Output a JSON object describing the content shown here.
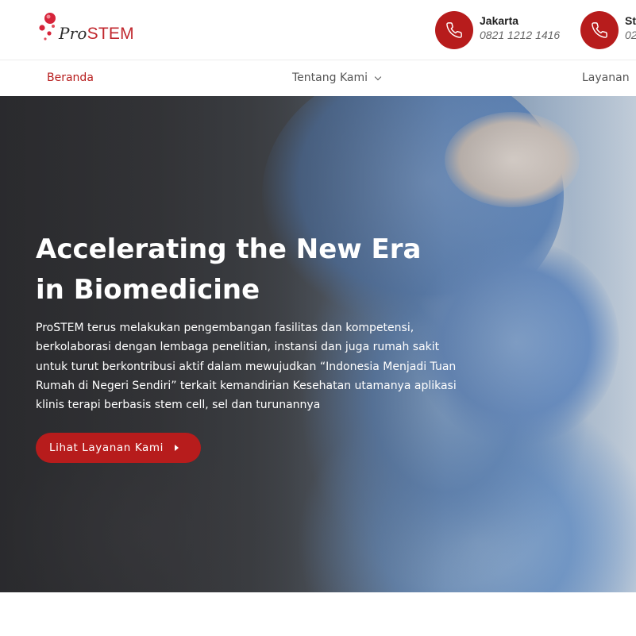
{
  "brand": {
    "logo_prefix": "Pro",
    "logo_suffix": "STEM",
    "accent_color": "#b71c1c"
  },
  "contacts": [
    {
      "city": "Jakarta",
      "phone": "0821 1212 1416",
      "icon": "phone-icon"
    },
    {
      "city": "St",
      "phone": "02",
      "icon": "phone-icon"
    }
  ],
  "nav": {
    "items": [
      {
        "label": "Beranda",
        "active": true
      },
      {
        "label": "Tentang Kami",
        "has_dropdown": true
      },
      {
        "label": "Layanan"
      }
    ]
  },
  "hero": {
    "title_line1": "Accelerating the New Era",
    "title_line2": "in Biomedicine",
    "description": "ProSTEM terus melakukan pengembangan fasilitas dan kompetensi, berkolaborasi dengan lembaga penelitian, instansi dan juga rumah sakit untuk turut berkontribusi aktif dalam mewujudkan “Indonesia Menjadi Tuan Rumah di Negeri Sendiri” terkait kemandirian Kesehatan utamanya aplikasi klinis terapi berbasis stem cell, sel dan turunannya",
    "cta_label": "Lihat Layanan Kami"
  }
}
